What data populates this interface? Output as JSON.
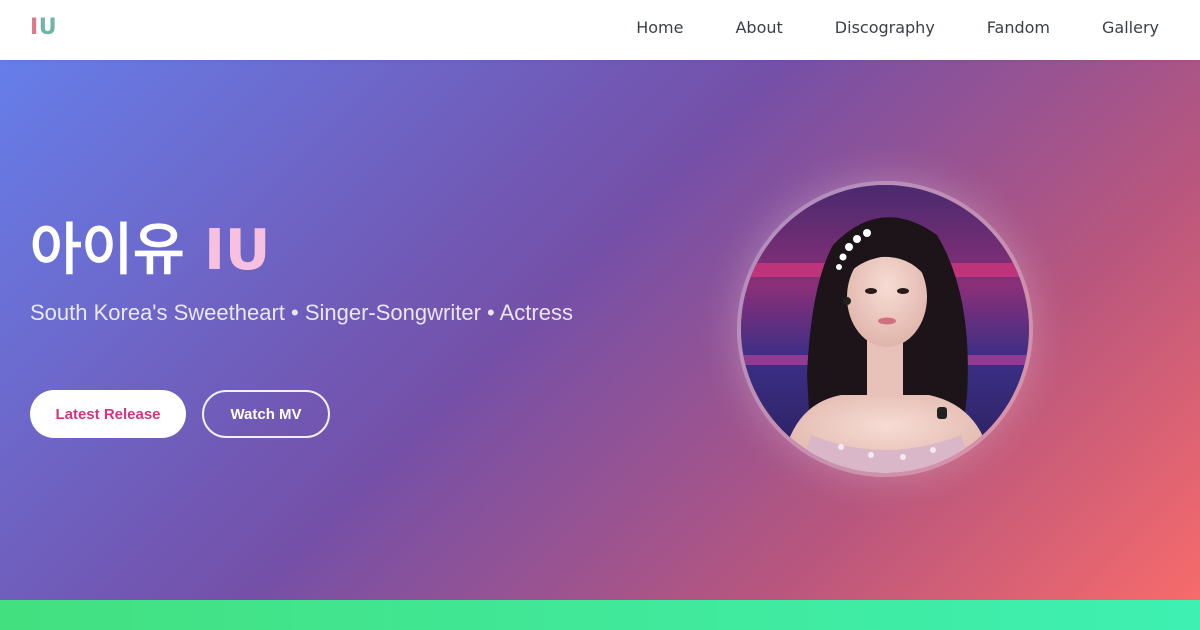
{
  "brand": {
    "logo_first": "I",
    "logo_second": "U",
    "logo_colors": [
      "#e07a8a",
      "#6fb6a8"
    ]
  },
  "nav": {
    "links": [
      {
        "label": "Home"
      },
      {
        "label": "About"
      },
      {
        "label": "Discography"
      },
      {
        "label": "Fandom"
      },
      {
        "label": "Gallery"
      }
    ]
  },
  "hero": {
    "title_korean": "아이유",
    "title_latin": "IU",
    "subtitle": "South Korea's Sweetheart • Singer-Songwriter • Actress",
    "primary_button": "Latest Release",
    "secondary_button": "Watch MV",
    "gradient_colors": [
      "#667eea",
      "#7450a8",
      "#b8567e",
      "#f76b6b"
    ],
    "accent_color": "#f6c1df"
  },
  "footer_bar": {
    "gradient_colors": [
      "#43e07f",
      "#3ef0b2"
    ]
  }
}
